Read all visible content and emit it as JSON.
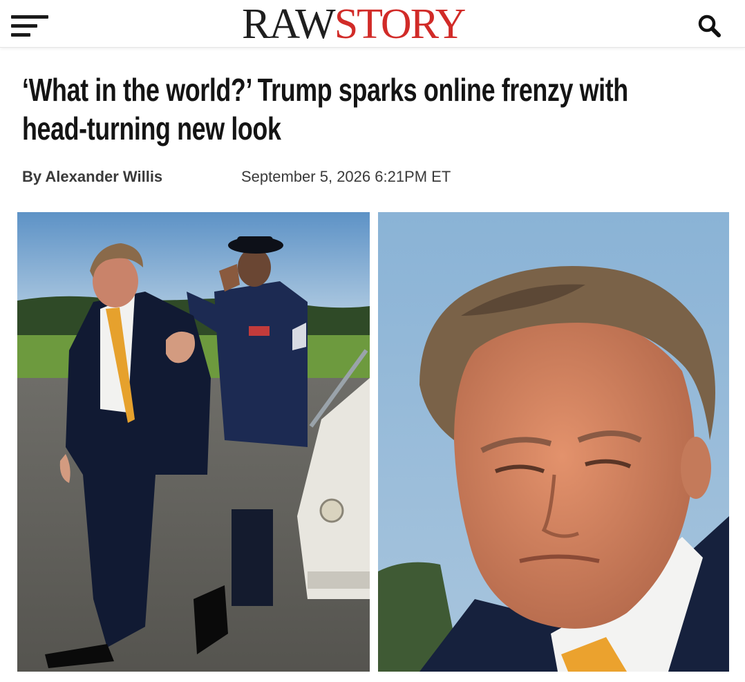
{
  "header": {
    "logo_part1": "RAW",
    "logo_part2": "STORY",
    "menu_icon": "hamburger-menu-icon",
    "search_icon": "search-icon",
    "colors": {
      "logo_dark": "#1f1f1f",
      "logo_red": "#d12b28"
    }
  },
  "article": {
    "headline": "‘What in the world?’ Trump sparks online frenzy with head-turning new look",
    "byline": "By Alexander Willis",
    "date": "September 5, 2026 6:21PM ET"
  }
}
